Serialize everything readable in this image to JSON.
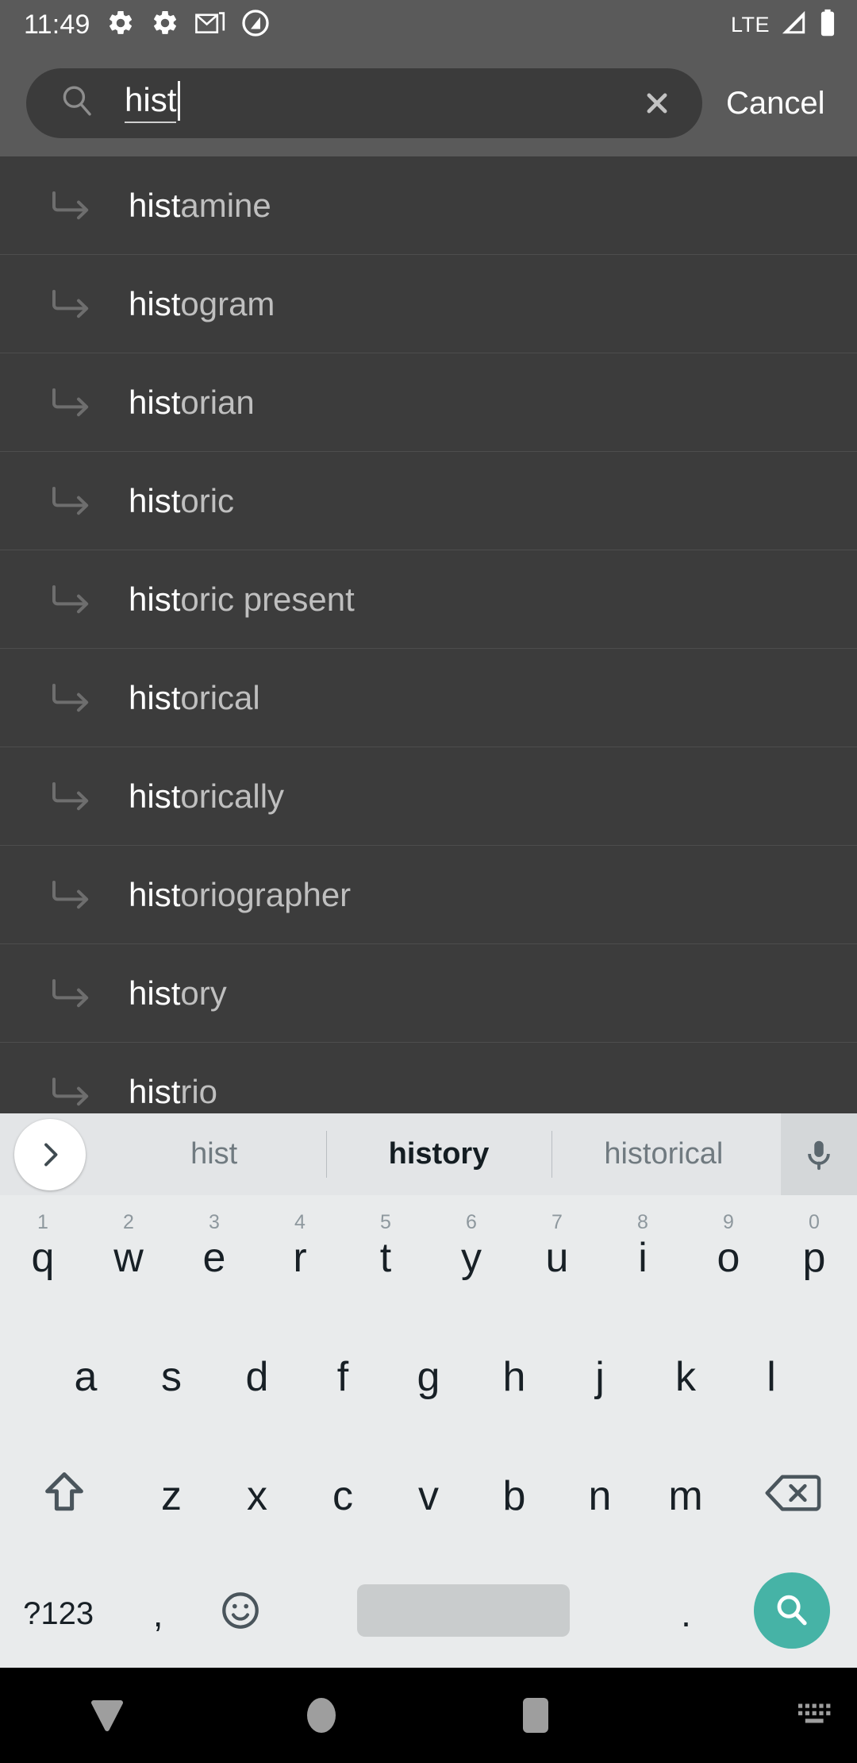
{
  "status_bar": {
    "time": "11:49",
    "network_label": "LTE",
    "left_icons": [
      "gear-icon",
      "gear-icon",
      "gmail-icon",
      "do-not-disturb-icon"
    ],
    "right_icons": [
      "signal-icon",
      "battery-icon"
    ],
    "background_color": "#5a5a5a"
  },
  "search": {
    "value": "hist",
    "placeholder": "Search",
    "search_icon": "magnifier-icon",
    "clear_icon": "close-icon",
    "cancel_label": "Cancel",
    "pill_color": "#3b3b3b"
  },
  "suggestions": {
    "prefix": "hist",
    "items": [
      {
        "prefix": "hist",
        "rest": "amine"
      },
      {
        "prefix": "hist",
        "rest": "ogram"
      },
      {
        "prefix": "hist",
        "rest": "orian"
      },
      {
        "prefix": "hist",
        "rest": "oric"
      },
      {
        "prefix": "hist",
        "rest": "oric present"
      },
      {
        "prefix": "hist",
        "rest": "orical"
      },
      {
        "prefix": "hist",
        "rest": "orically"
      },
      {
        "prefix": "hist",
        "rest": "oriographer"
      },
      {
        "prefix": "hist",
        "rest": "ory"
      },
      {
        "prefix": "hist",
        "rest": "rio"
      }
    ],
    "row_icon": "return-arrow-icon",
    "background_color": "#3c3c3c"
  },
  "keyboard": {
    "background_color": "#e9ebec",
    "suggestion_strip": {
      "expand_icon": "chevron-right-icon",
      "mic_icon": "microphone-icon",
      "candidates": [
        {
          "label": "hist",
          "active": false
        },
        {
          "label": "history",
          "active": true
        },
        {
          "label": "historical",
          "active": false
        }
      ]
    },
    "row1": [
      {
        "key": "q",
        "hint": "1"
      },
      {
        "key": "w",
        "hint": "2"
      },
      {
        "key": "e",
        "hint": "3"
      },
      {
        "key": "r",
        "hint": "4"
      },
      {
        "key": "t",
        "hint": "5"
      },
      {
        "key": "y",
        "hint": "6"
      },
      {
        "key": "u",
        "hint": "7"
      },
      {
        "key": "i",
        "hint": "8"
      },
      {
        "key": "o",
        "hint": "9"
      },
      {
        "key": "p",
        "hint": "0"
      }
    ],
    "row2": [
      {
        "key": "a"
      },
      {
        "key": "s"
      },
      {
        "key": "d"
      },
      {
        "key": "f"
      },
      {
        "key": "g"
      },
      {
        "key": "h"
      },
      {
        "key": "j"
      },
      {
        "key": "k"
      },
      {
        "key": "l"
      }
    ],
    "row3": {
      "shift_icon": "shift-arrow-icon",
      "letters": [
        {
          "key": "z"
        },
        {
          "key": "x"
        },
        {
          "key": "c"
        },
        {
          "key": "v"
        },
        {
          "key": "b"
        },
        {
          "key": "n"
        },
        {
          "key": "m"
        }
      ],
      "backspace_icon": "backspace-icon"
    },
    "row4": {
      "symbols_label": "?123",
      "comma": ",",
      "emoji_icon": "emoji-smiley-icon",
      "space_label": "",
      "period": ".",
      "enter_icon": "search-icon",
      "enter_color": "#46b3a6"
    }
  },
  "nav_bar": {
    "background_color": "#000000",
    "buttons": [
      {
        "icon": "down-triangle-icon",
        "name": "dismiss-keyboard"
      },
      {
        "icon": "circle-icon",
        "name": "home"
      },
      {
        "icon": "square-icon",
        "name": "recents"
      }
    ],
    "keyboard_indicator_icon": "keyboard-icon"
  }
}
